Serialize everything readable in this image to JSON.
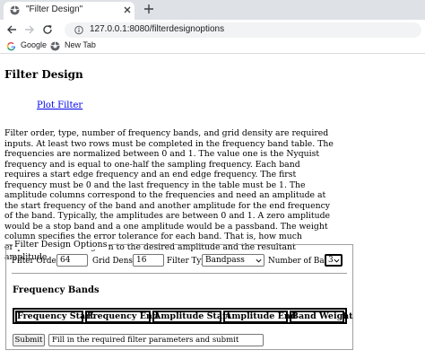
{
  "browser": {
    "tab_title": "\"Filter Design\"",
    "url": "127.0.0.1:8080/filterdesignoptions",
    "bookmarks": [
      {
        "label": "Google",
        "icon": "google-icon"
      },
      {
        "label": "New Tab",
        "icon": "globe-icon"
      }
    ]
  },
  "page": {
    "title": "Filter Design",
    "plot_link": "Plot Filter",
    "description": "Filter order, type, number of frequency bands, and grid density are required inputs. At least two rows must be completed in the frequency band table. The frequencies are normalized between 0 and 1. The value one is the Nyquist frequency and is equal to one-half the sampling frequency. Each band requires a start edge frequency and an end edge frequency. The first frequency must be 0 and the last frequency in the table must be 1. The amplitude columns correspond to the frequencies and need an amplitude at the start frequency of the band and another amplitude for the end frequency of the band. Typically, the amplitudes are between 0 and 1. A zero amplitude would be a stop band and a one amplitude would be a passband. The weight column specifies the error tolerance for each band. That is, how much emphasis should be given to the desired amplitude and the resultant amplitude."
  },
  "form": {
    "legend": "Filter Design Options",
    "filter_order_label": "Filter Order:",
    "filter_order_value": "64",
    "grid_density_label": "Grid Density:",
    "grid_density_value": "16",
    "filter_type_label": "Filter Type:",
    "filter_type_value": "Bandpass",
    "num_bands_label": "Number of Bands:",
    "num_bands_value": "3",
    "bands_title": "Frequency Bands",
    "columns": [
      "Frequency Start",
      "Frequency End",
      "Amplitude Start",
      "Amplitude End",
      "Band Weight"
    ],
    "submit_label": "Submit",
    "status_text": "Fill in the required filter parameters and submit"
  },
  "colors": {
    "tabstrip": "#dee1e6",
    "omnibox": "#f1f3f4",
    "link": "#0000ee"
  }
}
